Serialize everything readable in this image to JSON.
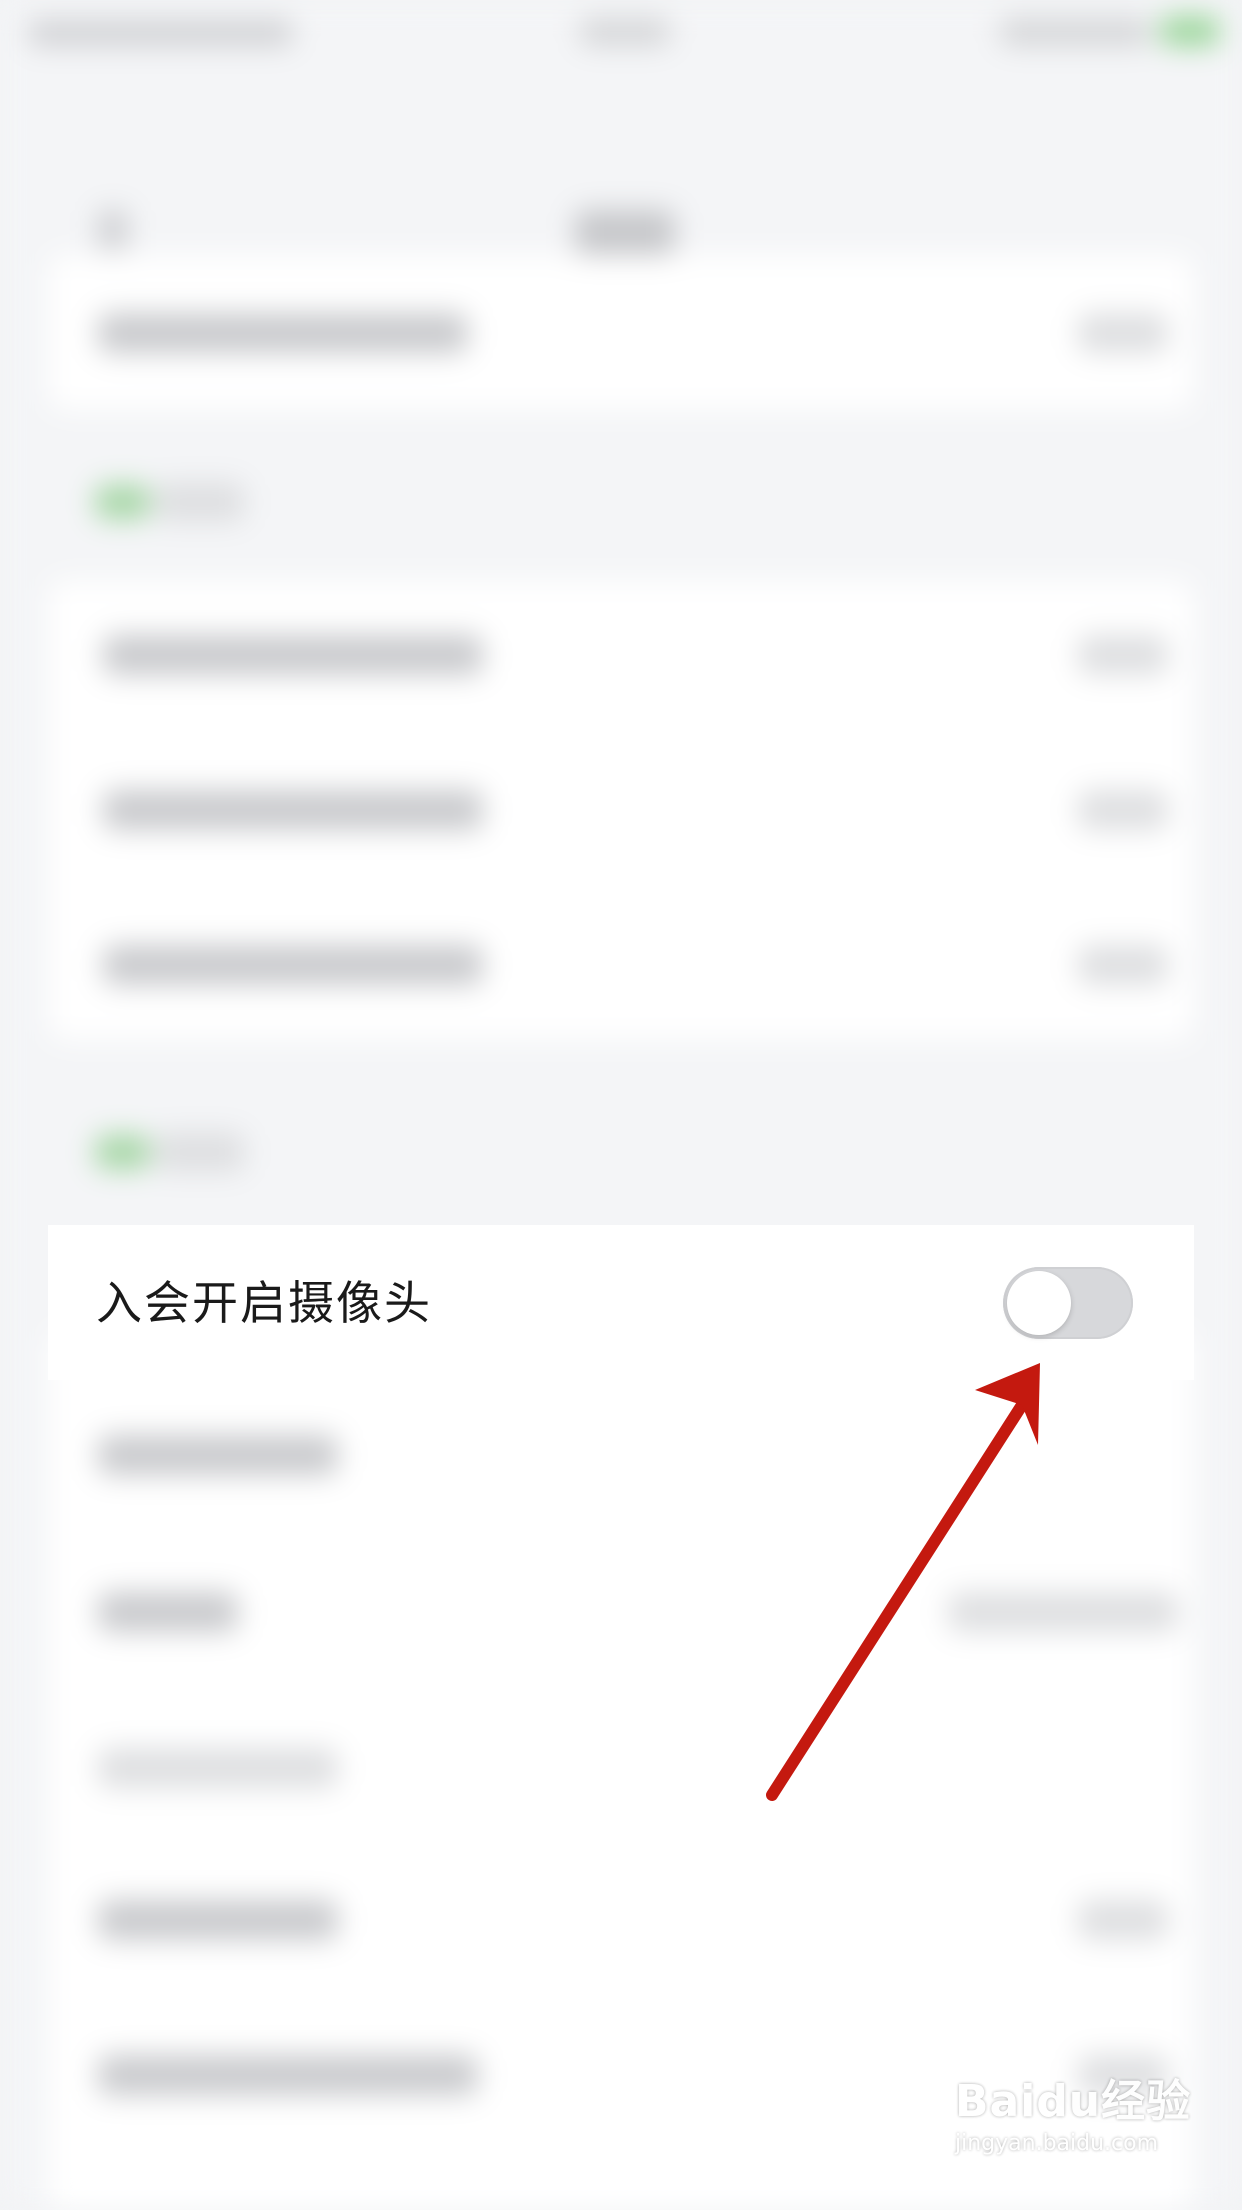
{
  "setting_row": {
    "label": "入会开启摄像头",
    "toggle_state": "off"
  },
  "watermark": {
    "brand": "Baidu经验",
    "url": "jingyan.baidu.com"
  },
  "annotation": {
    "arrow_color": "#c4190f"
  }
}
